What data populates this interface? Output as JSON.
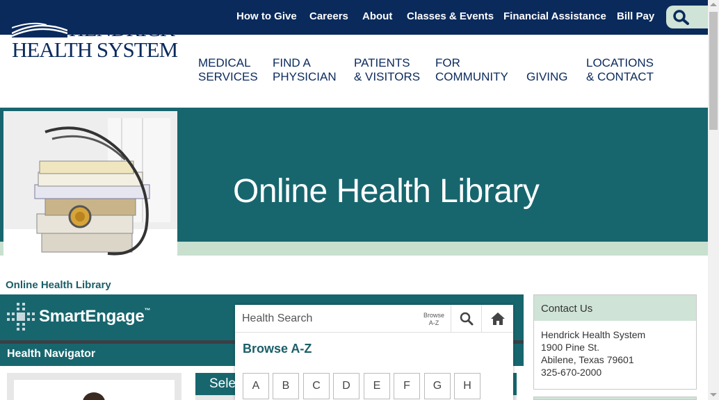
{
  "utility_nav": {
    "items": [
      "How to Give",
      "Careers",
      "About",
      "Classes & Events",
      "Financial Assistance",
      "Bill Pay"
    ],
    "search_icon": "search-icon",
    "background": "#0a2a5c"
  },
  "logo": {
    "line1": "HENDRICK",
    "line2": "HEALTH SYSTEM"
  },
  "main_nav": {
    "items": [
      {
        "line1": "MEDICAL",
        "line2": "SERVICES"
      },
      {
        "line1": "FIND A",
        "line2": "PHYSICIAN"
      },
      {
        "line1": "PATIENTS",
        "line2": "& VISITORS"
      },
      {
        "line1": "FOR",
        "line2": "COMMUNITY"
      },
      {
        "line1": "GIVING",
        "line2": ""
      },
      {
        "line1": "LOCATIONS",
        "line2": "& CONTACT"
      }
    ]
  },
  "banner": {
    "title": "Online Health Library",
    "accent": "#17666e",
    "mint": "#c9e0cf"
  },
  "breadcrumb": "Online Health Library",
  "smartengage": {
    "logo_text": "SmartEngage",
    "tm": "™",
    "navigator_title": "Health Navigator",
    "select_text": "Sele"
  },
  "search": {
    "placeholder": "Health Search",
    "browse_line1": "Browse",
    "browse_line2": "A-Z",
    "browse_title": "Browse A-Z",
    "letters": [
      "A",
      "B",
      "C",
      "D",
      "E",
      "F",
      "G",
      "H"
    ]
  },
  "contact": {
    "title": "Contact Us",
    "name": "Hendrick Health System",
    "street": "1900 Pine St.",
    "city": "Abilene, Texas 79601",
    "phone": "325-670-2000"
  }
}
